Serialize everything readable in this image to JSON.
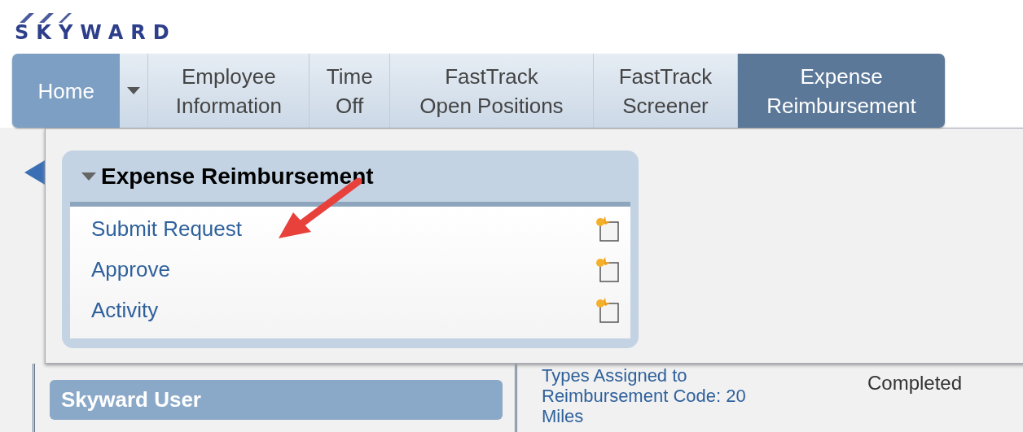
{
  "logo": {
    "text": "SKYWARD"
  },
  "nav": [
    {
      "kind": "home",
      "label": "Home",
      "selected": false
    },
    {
      "kind": "tab",
      "label": "Employee\nInformation",
      "selected": false
    },
    {
      "kind": "tab",
      "label": "Time\nOff",
      "selected": false
    },
    {
      "kind": "tab",
      "label": "FastTrack\nOpen Positions",
      "selected": false
    },
    {
      "kind": "tab",
      "label": "FastTrack\nScreener",
      "selected": false
    },
    {
      "kind": "tab",
      "label": "Expense\nReimbursement",
      "selected": true
    }
  ],
  "menu": {
    "title": "Expense Reimbursement",
    "expanded": true,
    "items": [
      "Submit Request",
      "Approve",
      "Activity"
    ]
  },
  "sidebar": {
    "user": "Skyward User"
  },
  "task": {
    "text": "Types Assigned to\nReimbursement Code: 20\nMiles",
    "status": "Completed"
  }
}
